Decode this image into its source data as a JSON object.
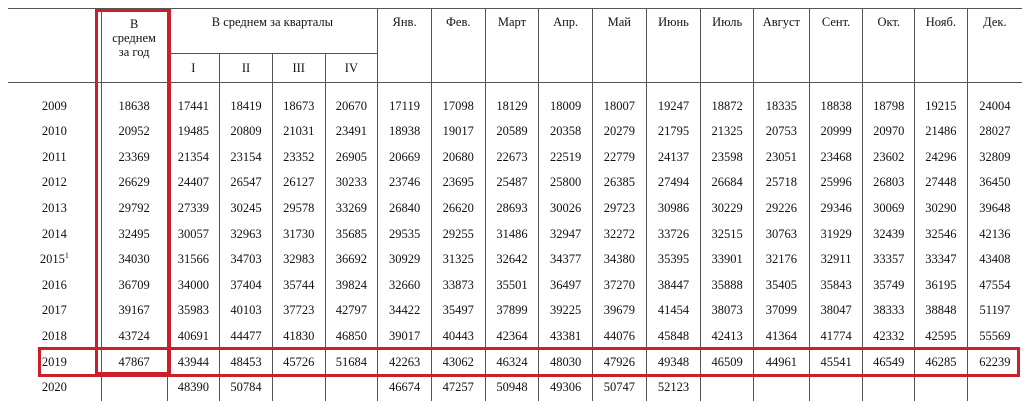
{
  "header": {
    "year_col": "",
    "annual": "В среднем за год",
    "quarters_group": "В среднем за кварталы",
    "quarters": [
      "I",
      "II",
      "III",
      "IV"
    ],
    "months": [
      "Янв.",
      "Фев.",
      "Март",
      "Апр.",
      "Май",
      "Июнь",
      "Июль",
      "Август",
      "Сент.",
      "Окт.",
      "Нояб.",
      "Дек."
    ]
  },
  "rows": [
    {
      "year": "2009",
      "sup": "",
      "cells": [
        "18638",
        "17441",
        "18419",
        "18673",
        "20670",
        "17119",
        "17098",
        "18129",
        "18009",
        "18007",
        "19247",
        "18872",
        "18335",
        "18838",
        "18798",
        "19215",
        "24004"
      ]
    },
    {
      "year": "2010",
      "sup": "",
      "cells": [
        "20952",
        "19485",
        "20809",
        "21031",
        "23491",
        "18938",
        "19017",
        "20589",
        "20358",
        "20279",
        "21795",
        "21325",
        "20753",
        "20999",
        "20970",
        "21486",
        "28027"
      ]
    },
    {
      "year": "2011",
      "sup": "",
      "cells": [
        "23369",
        "21354",
        "23154",
        "23352",
        "26905",
        "20669",
        "20680",
        "22673",
        "22519",
        "22779",
        "24137",
        "23598",
        "23051",
        "23468",
        "23602",
        "24296",
        "32809"
      ]
    },
    {
      "year": "2012",
      "sup": "",
      "cells": [
        "26629",
        "24407",
        "26547",
        "26127",
        "30233",
        "23746",
        "23695",
        "25487",
        "25800",
        "26385",
        "27494",
        "26684",
        "25718",
        "25996",
        "26803",
        "27448",
        "36450"
      ]
    },
    {
      "year": "2013",
      "sup": "",
      "cells": [
        "29792",
        "27339",
        "30245",
        "29578",
        "33269",
        "26840",
        "26620",
        "28693",
        "30026",
        "29723",
        "30986",
        "30229",
        "29226",
        "29346",
        "30069",
        "30290",
        "39648"
      ]
    },
    {
      "year": "2014",
      "sup": "",
      "cells": [
        "32495",
        "30057",
        "32963",
        "31730",
        "35685",
        "29535",
        "29255",
        "31486",
        "32947",
        "32272",
        "33726",
        "32515",
        "30763",
        "31929",
        "32439",
        "32546",
        "42136"
      ]
    },
    {
      "year": "2015",
      "sup": "1",
      "cells": [
        "34030",
        "31566",
        "34703",
        "32983",
        "36692",
        "30929",
        "31325",
        "32642",
        "34377",
        "34380",
        "35395",
        "33901",
        "32176",
        "32911",
        "33357",
        "33347",
        "43408"
      ]
    },
    {
      "year": "2016",
      "sup": "",
      "cells": [
        "36709",
        "34000",
        "37404",
        "35744",
        "39824",
        "32660",
        "33873",
        "35501",
        "36497",
        "37270",
        "38447",
        "35888",
        "35405",
        "35843",
        "35749",
        "36195",
        "47554"
      ]
    },
    {
      "year": "2017",
      "sup": "",
      "cells": [
        "39167",
        "35983",
        "40103",
        "37723",
        "42797",
        "34422",
        "35497",
        "37899",
        "39225",
        "39679",
        "41454",
        "38073",
        "37099",
        "38047",
        "38333",
        "38848",
        "51197"
      ]
    },
    {
      "year": "2018",
      "sup": "",
      "cells": [
        "43724",
        "40691",
        "44477",
        "41830",
        "46850",
        "39017",
        "40443",
        "42364",
        "43381",
        "44076",
        "45848",
        "42413",
        "41364",
        "41774",
        "42332",
        "42595",
        "55569"
      ]
    },
    {
      "year": "2019",
      "sup": "",
      "cells": [
        "47867",
        "43944",
        "48453",
        "45726",
        "51684",
        "42263",
        "43062",
        "46324",
        "48030",
        "47926",
        "49348",
        "46509",
        "44961",
        "45541",
        "46549",
        "46285",
        "62239"
      ]
    },
    {
      "year": "2020",
      "sup": "",
      "cells": [
        "",
        "48390",
        "50784",
        "",
        "",
        "46674",
        "47257",
        "50948",
        "49306",
        "50747",
        "52123",
        "",
        "",
        "",
        "",
        "",
        ""
      ]
    }
  ],
  "highlight": {
    "color": "#cc1f2b",
    "column": "В среднем за год",
    "row": "2019"
  }
}
